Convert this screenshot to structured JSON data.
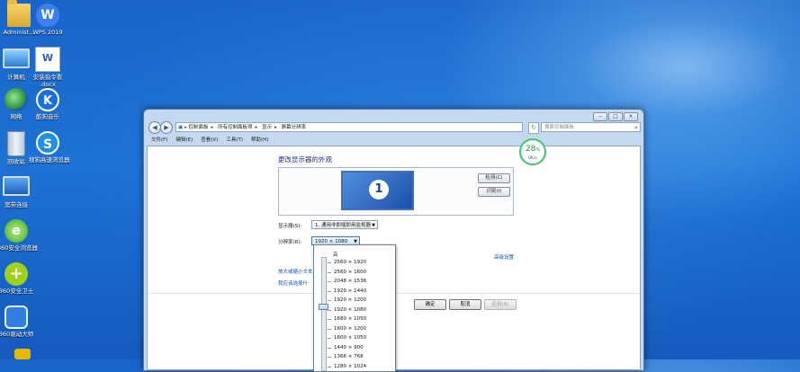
{
  "desktop": {
    "icons": [
      {
        "label": "Administ..."
      },
      {
        "label": "WPS 2019"
      },
      {
        "label": "计算机"
      },
      {
        "label": "安装指令看 .docx"
      },
      {
        "label": "网络"
      },
      {
        "label": "酷狗音乐"
      },
      {
        "label": "回收站"
      },
      {
        "label": "搜狗高速浏览器"
      },
      {
        "label": "宽带连接"
      },
      {
        "label": "360安全浏览器"
      },
      {
        "label": "360安全卫士"
      },
      {
        "label": "360驱动大师"
      }
    ]
  },
  "window": {
    "address": [
      "控制面板",
      "所有控制面板项",
      "显示",
      "屏幕分辨率"
    ],
    "search_placeholder": "搜索控制面板",
    "menu": [
      "文件(F)",
      "编辑(E)",
      "查看(V)",
      "工具(T)",
      "帮助(H)"
    ],
    "title": "更改显示器的外观",
    "monitor_number": "1",
    "detect_label": "检测(C)",
    "identify_label": "识别(I)",
    "display_label": "显示器(S):",
    "display_value": "1. 通用非即插即用监视器",
    "resolution_label": "分辨率(R):",
    "resolution_value": "1920 × 1080",
    "advanced_link": "高级设置",
    "link1": "放大或缩小文本",
    "link2": "我应该选择什",
    "ok_label": "确定",
    "cancel_label": "取消",
    "apply_label": "应用(A)"
  },
  "resolution_popup": {
    "high_label": "高",
    "options": [
      "2560 × 1920",
      "2560 × 1600",
      "2048 × 1536",
      "1920 × 1440",
      "1920 × 1200",
      "1920 × 1080",
      "1680 × 1050",
      "1600 × 1200",
      "1600 × 1050",
      "1440 × 900",
      "1366 × 768",
      "1280 × 1024"
    ],
    "selected": "1920 × 1080"
  },
  "net_meter": {
    "percent": "28",
    "percent_sign": "%",
    "speed": "0K/s"
  }
}
